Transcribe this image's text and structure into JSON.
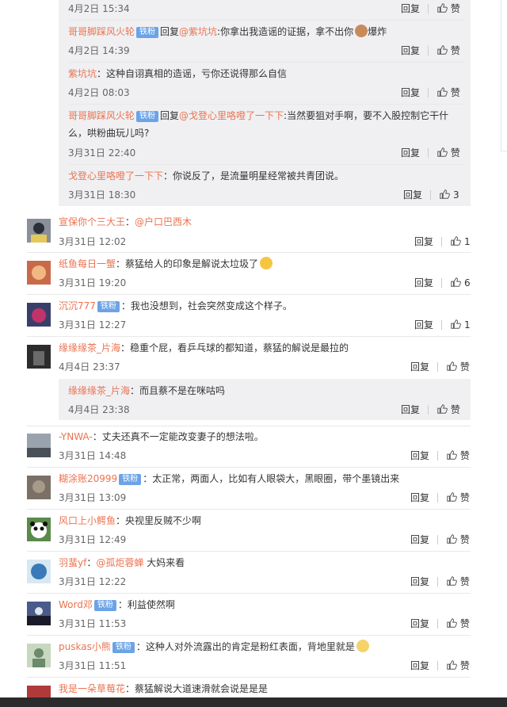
{
  "like_label": "赞",
  "reply_label": "回复",
  "nested_replies": [
    {
      "user": "",
      "badge": "",
      "prefix": "",
      "mention": "",
      "content": "",
      "content2": "",
      "time": "4月2日 15:34",
      "likes": ""
    },
    {
      "user": "哥哥脚踩风火轮",
      "badge": "铁粉",
      "prefix": "回复",
      "mention": "@紫坑坑",
      "content": ":你拿出我造谣的证据，拿不出你",
      "content_tail": "爆炸",
      "time": "4月2日 14:39",
      "likes": ""
    },
    {
      "user": "紫坑坑",
      "badge": "",
      "prefix": "",
      "mention": "",
      "content": "：这种自诩真相的造谣，亏你还说得那么自信",
      "time": "4月2日 08:03",
      "likes": ""
    },
    {
      "user": "哥哥脚踩风火轮",
      "badge": "铁粉",
      "prefix": "回复",
      "mention": "@戈登心里咯噔了一下下",
      "content": ":当然要狙对手啊，要不入股控制它干什",
      "content2": "么，哄粉曲玩儿吗?",
      "time": "3月31日 22:40",
      "likes": ""
    },
    {
      "user": "戈登心里咯噔了一下下",
      "badge": "",
      "prefix": "",
      "mention": "",
      "content": "：你说反了，是流量明星经常被共青团说。",
      "time": "3月31日 18:30",
      "likes": "3"
    }
  ],
  "comments": [
    {
      "user": "宣保你个三大王",
      "badge": "",
      "content": "：",
      "mention": "@户口巴西木",
      "time": "3月31日 12:02",
      "likes": "1"
    },
    {
      "user": "纸鱼每日一蟹",
      "badge": "",
      "content": "：蔡猛给人的印象是解说太垃圾了",
      "time": "3月31日 19:20",
      "likes": "6"
    },
    {
      "user": "沉沉777",
      "badge": "铁粉",
      "content": "：我也没想到，社会突然变成这个样子。",
      "time": "3月31日 12:27",
      "likes": "1"
    },
    {
      "user": "缘缘缘茶_片海",
      "badge": "",
      "content": "：稳重个屁，看乒乓球的都知道，蔡猛的解说是最拉的",
      "time": "4月4日 23:37",
      "likes": ""
    },
    {
      "user": "-YNWA-",
      "badge": "",
      "content": "：丈夫还真不一定能改变妻子的想法啦。",
      "time": "3月31日 14:48",
      "likes": ""
    },
    {
      "user": "糊涂账20999",
      "badge": "铁粉",
      "content": "：太正常，两面人，比如有人眼袋大，黑眼圈，带个墨镜出来",
      "time": "3月31日 13:09",
      "likes": ""
    },
    {
      "user": "风口上小鳄鱼",
      "badge": "",
      "content": "：央视里反贼不少啊",
      "time": "3月31日 12:49",
      "likes": ""
    },
    {
      "user": "羽蜚yf",
      "badge": "",
      "content": "：",
      "mention": "@孤炬蓉蝉",
      "content_tail": " 大妈来看",
      "time": "3月31日 12:22",
      "likes": ""
    },
    {
      "user": "Word邓",
      "badge": "铁粉",
      "content": "：利益使然啊",
      "time": "3月31日 11:53",
      "likes": ""
    },
    {
      "user": "puskas小熊",
      "badge": "铁粉",
      "content": "：这种人对外流露出的肯定是粉红表面，背地里就是",
      "time": "3月31日 11:51",
      "likes": ""
    },
    {
      "user": "我是一朵草莓花",
      "badge": "",
      "content": "：蔡猛解说大道速滑就会说是是是",
      "time": "",
      "likes": ""
    }
  ],
  "sub_reply": {
    "user": "缘缘缘茶_片海",
    "content": "：而且蔡不是在咪咕吗",
    "time": "4月4日 23:38"
  },
  "colors": {
    "username": "#eb7350",
    "badge": "#6ca3e8",
    "reply_bg": "#f0f0f2"
  }
}
